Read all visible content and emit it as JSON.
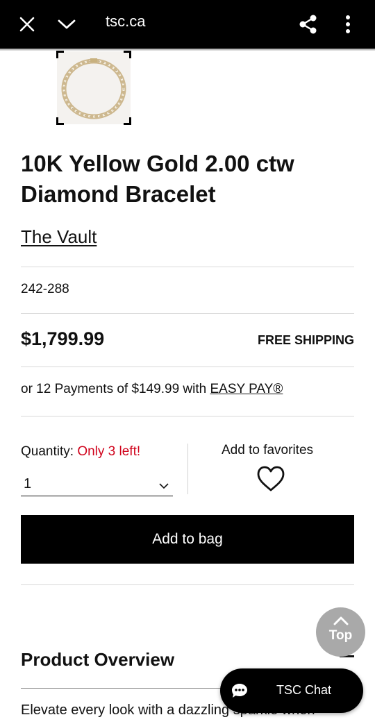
{
  "browser": {
    "url": "tsc.ca"
  },
  "product": {
    "title_line1": "10K Yellow Gold 2.00 ctw",
    "title_line2": "Diamond Bracelet",
    "brand": "The Vault",
    "sku": "242-288",
    "price": "$1,799.99",
    "shipping": "FREE SHIPPING",
    "payments_prefix": "or 12 Payments of $149.99 with ",
    "easy_pay": "EASY PAY®"
  },
  "quantity": {
    "label": "Quantity: ",
    "stock_warning": "Only 3 left!",
    "value": "1"
  },
  "favorites": {
    "label": "Add to favorites"
  },
  "add_to_bag": {
    "label": "Add to bag"
  },
  "scroll_top": {
    "label": "Top"
  },
  "overview": {
    "heading": "Product Overview",
    "text": "Elevate every look with a dazzling sparkle when"
  },
  "chat": {
    "label": "TSC Chat"
  },
  "colors": {
    "accent_black": "#000000",
    "warning_red": "#d0021b",
    "top_button_gray": "#a9a9a9"
  }
}
